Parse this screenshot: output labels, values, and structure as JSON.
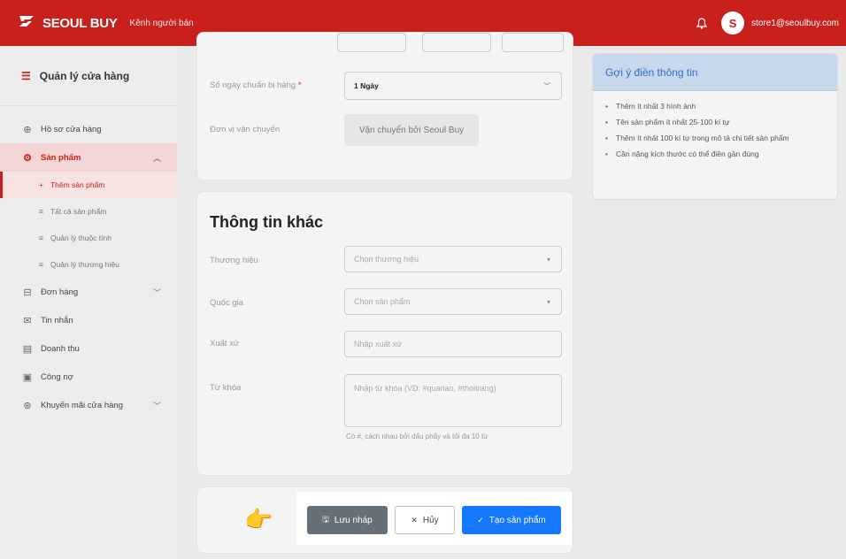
{
  "header": {
    "brand": "SEOUL BUY",
    "channel": "Kênh người bán",
    "user_email": "store1@seoulbuy.com",
    "avatar_initial": "S",
    "logo_icon": "s-logo-icon",
    "bell_icon": "bell-icon"
  },
  "sidebar": {
    "title": "Quản lý cửa hàng",
    "items": [
      {
        "label": "Hồ sơ cửa hàng",
        "icon": "store-icon"
      },
      {
        "label": "Sản phẩm",
        "icon": "gear-icon"
      },
      {
        "label": "Đơn hàng",
        "icon": "cart-icon"
      },
      {
        "label": "Tin nhắn",
        "icon": "chat-icon"
      },
      {
        "label": "Doanh thu",
        "icon": "revenue-icon"
      },
      {
        "label": "Công nợ",
        "icon": "debt-icon"
      },
      {
        "label": "Khuyến mãi cửa hàng",
        "icon": "promo-icon"
      }
    ],
    "sub_items": [
      {
        "label": "Thêm sản phẩm"
      },
      {
        "label": "Tất cả sản phẩm"
      },
      {
        "label": "Quản lý thuộc tính"
      },
      {
        "label": "Quản lý thương hiệu"
      }
    ]
  },
  "shipping": {
    "prep_days_label": "Số ngày chuẩn bị hàng",
    "required_mark": "*",
    "prep_days_value": "1 Ngày",
    "carrier_label": "Đơn vị vận chuyển",
    "carrier_value": "Vận chuyển bởi Seoul Buy"
  },
  "other_info": {
    "title": "Thông tin khác",
    "brand_label": "Thương hiệu",
    "brand_placeholder": "Chọn thương hiệu",
    "country_label": "Quốc gia",
    "country_placeholder": "Chọn sản phẩm",
    "origin_label": "Xuất xứ",
    "origin_placeholder": "Nhập xuất xứ",
    "keyword_label": "Từ khóa",
    "keyword_placeholder": "Nhập từ khóa (VD: #quanao, #thoitrang)",
    "keyword_hint": "Có #, cách nhau bởi dấu phẩy và tối đa 10 từ"
  },
  "tips": {
    "title": "Gợi ý điền thông tin",
    "items": [
      "Thêm ít nhất 3 hình ảnh",
      "Tên sản phẩm ít nhất 25-100 kí tự",
      "Thêm ít nhất 100 kí tự trong mô tả chi tiết sản phẩm",
      "Cân nặng kích thước có thể điền gần đúng"
    ]
  },
  "actions": {
    "draft": "Lưu nháp",
    "cancel": "Hủy",
    "create": "Tạo sản phẩm"
  },
  "colors": {
    "brand": "#c8201c",
    "primary": "#1677ff",
    "draft": "#676f77"
  }
}
